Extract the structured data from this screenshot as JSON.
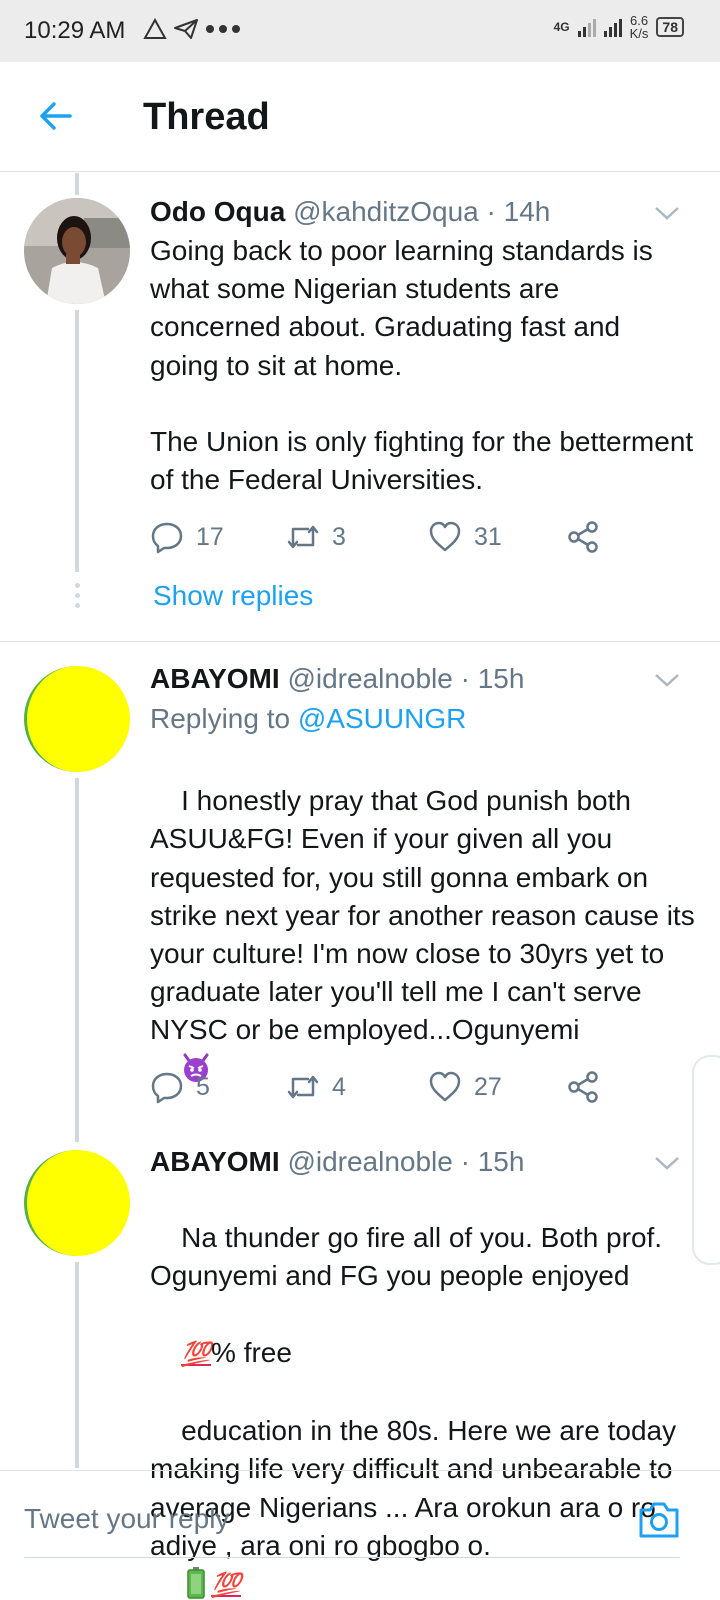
{
  "status_bar": {
    "time": "10:29 AM",
    "network": "4G",
    "speed_value": "6.6",
    "speed_unit": "K/s",
    "battery": "78"
  },
  "header": {
    "title": "Thread"
  },
  "tweets": [
    {
      "name": "Odo Oqua",
      "handle": "@kahditzOqua · 14h",
      "text": "Going back to poor learning standards is what some Nigerian students are concerned about. Graduating fast and going to sit at home.\n\nThe Union is only fighting for the betterment of the Federal Universities.",
      "replies": "17",
      "retweets": "3",
      "likes": "31"
    },
    {
      "name": "ABAYOMI",
      "handle": "@idrealnoble · 15h",
      "replying_to_label": "Replying to",
      "replying_to_user": "@ASUUNGR",
      "text": "I honestly pray that God punish both ASUU&FG! Even if your given all you requested for, you still gonna embark on strike next year for another reason cause its your culture! I'm now close to 30yrs yet to graduate later you'll tell me I can't serve NYSC or be employed...Ogunyemi",
      "replies": "5",
      "retweets": "4",
      "likes": "27"
    },
    {
      "name": "ABAYOMI",
      "handle": "@idrealnoble · 15h",
      "text_line1": "Na thunder go fire all of you. Both prof. Ogunyemi and FG you people enjoyed",
      "text_100": "💯",
      "text_line2": "% free",
      "text_line3": "education in the 80s. Here we are today making life very difficult and unbearable to average Nigerians ... Ara orokun ara o ro adiye , ara oni ro gbogbo o.",
      "text_end_100": "💯"
    }
  ],
  "show_replies": "Show replies",
  "composer": {
    "placeholder": "Tweet your reply"
  },
  "colors": {
    "accent": "#1da1f2",
    "secondary_text": "#657786",
    "divider": "#dfe3e6",
    "avatar_yellow": "#ffff00"
  },
  "icons": [
    "back-arrow-icon",
    "reply-icon",
    "retweet-icon",
    "like-icon",
    "share-icon",
    "chevron-down-icon",
    "camera-icon"
  ]
}
